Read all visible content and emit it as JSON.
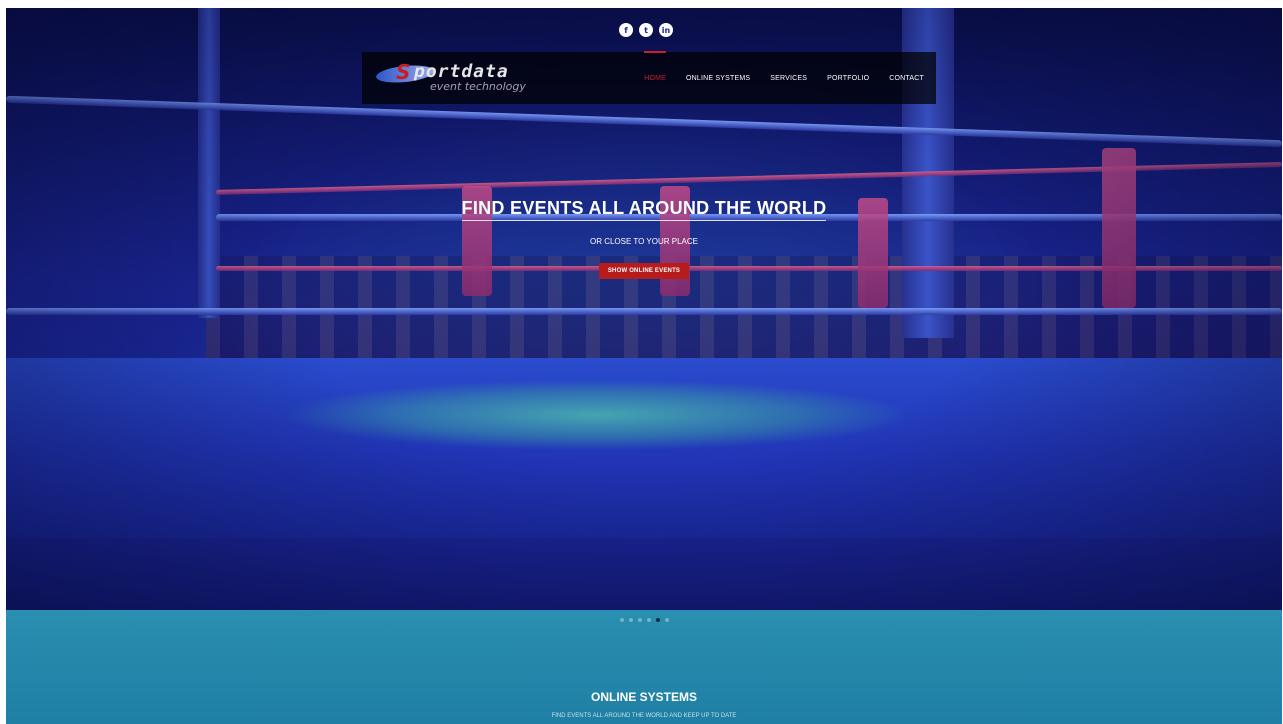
{
  "social": [
    {
      "glyph": "f",
      "icon": "facebook-icon"
    },
    {
      "glyph": "t",
      "icon": "twitter-icon"
    },
    {
      "glyph": "in",
      "icon": "linkedin-icon"
    }
  ],
  "brand": {
    "s_glyph": "S",
    "wordmark": "portdata",
    "tagline": "event technology"
  },
  "nav": {
    "items": [
      "HOME",
      "ONLINE SYSTEMS",
      "SERVICES",
      "PORTFOLIO",
      "CONTACT"
    ],
    "active_index": 0,
    "active_color": "#c8202a"
  },
  "hero": {
    "title": "FIND EVENTS ALL AROUND THE WORLD",
    "subtitle": "OR CLOSE TO YOUR PLACE",
    "cta_label": "SHOW ONLINE EVENTS",
    "cta_color": "#b71c1c"
  },
  "slider": {
    "count": 6,
    "active_index": 4
  },
  "section": {
    "title": "ONLINE SYSTEMS",
    "subtitle": "FIND EVENTS ALL AROUND THE WORLD AND KEEP UP TO DATE"
  }
}
